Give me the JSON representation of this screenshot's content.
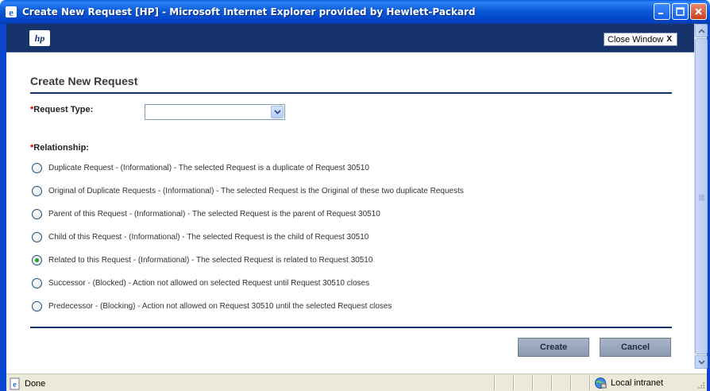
{
  "window": {
    "title": "Create New Request [HP] - Microsoft Internet Explorer provided by Hewlett-Packard"
  },
  "header": {
    "logo": "hp",
    "close_window_label": "Close Window",
    "close_window_glyph": "X"
  },
  "form": {
    "page_title": "Create New Request",
    "required_mark": "*",
    "request_type_label": "Request Type:",
    "request_type_value": "",
    "relationship_label": "Relationship:",
    "relationship_options": [
      {
        "label": "Duplicate Request - (Informational) - The selected Request is a duplicate of Request 30510",
        "selected": false
      },
      {
        "label": "Original of Duplicate Requests - (Informational) - The selected Request is the Original of these two duplicate Requests",
        "selected": false
      },
      {
        "label": "Parent of this Request - (Informational) - The selected Request is the parent of Request 30510",
        "selected": false
      },
      {
        "label": "Child of this Request - (Informational) - The selected Request is the child of Request 30510",
        "selected": false
      },
      {
        "label": "Related to this Request - (Informational) - The selected Request is related to Request 30510",
        "selected": true
      },
      {
        "label": "Successor - (Blocked) - Action not allowed on selected Request until Request 30510 closes",
        "selected": false
      },
      {
        "label": "Predecessor - (Blocking) - Action not allowed on Request 30510 until the selected Request closes",
        "selected": false
      }
    ],
    "create_label": "Create",
    "cancel_label": "Cancel"
  },
  "statusbar": {
    "status_text": "Done",
    "zone_text": "Local intranet"
  },
  "colors": {
    "header_bar": "#17336b",
    "required": "#d00000",
    "radio_selected": "#21a121"
  }
}
